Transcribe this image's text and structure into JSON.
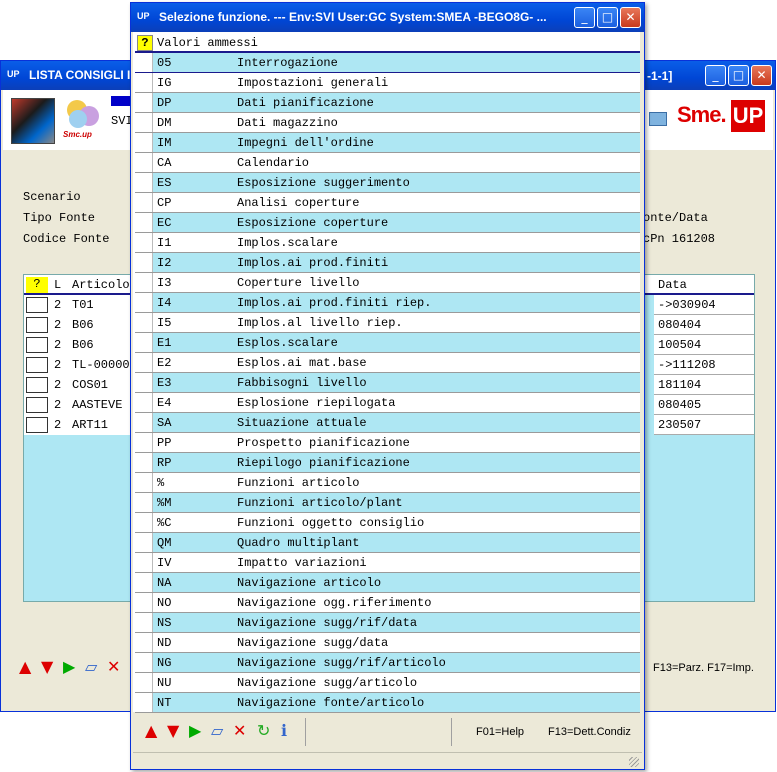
{
  "background_window": {
    "title": "LISTA CONSIGLI I",
    "title_right": "-1-1]",
    "toolbar": {
      "partial_text": "SVI",
      "logo_small": "Smc.up",
      "logo_sme": "Sme.",
      "logo_up": "UP"
    },
    "fields": [
      {
        "label": "Scenario",
        "value": ""
      },
      {
        "label": "Tipo Fonte",
        "value": "onte/Data"
      },
      {
        "label": "Codice Fonte",
        "value": "cPn  161208"
      }
    ],
    "table": {
      "headers": {
        "q": "?",
        "l": "L",
        "articolo": "Articolo",
        "data": "Data"
      },
      "rows": [
        {
          "l": "2",
          "articolo": "T01",
          "data": "->030904"
        },
        {
          "l": "2",
          "articolo": "B06",
          "data": "080404"
        },
        {
          "l": "2",
          "articolo": "B06",
          "data": "100504"
        },
        {
          "l": "2",
          "articolo": "TL-00000",
          "data": "->111208"
        },
        {
          "l": "2",
          "articolo": "COS01",
          "data": "181104"
        },
        {
          "l": "2",
          "articolo": "AASTEVE",
          "data": "080405"
        },
        {
          "l": "2",
          "articolo": "ART11",
          "data": "230507"
        }
      ]
    },
    "fkeys": "F13=Parz.  F17=Imp."
  },
  "dialog": {
    "title": "Selezione funzione. --- Env:SVI User:GC System:SMEA -BEGO8G- ...",
    "list_header": "Valori ammessi",
    "question_mark": "?",
    "options": [
      {
        "code": "05",
        "desc": "Interrogazione"
      },
      {
        "code": "IG",
        "desc": "Impostazioni generali"
      },
      {
        "code": "DP",
        "desc": "Dati pianificazione"
      },
      {
        "code": "DM",
        "desc": "Dati magazzino"
      },
      {
        "code": "IM",
        "desc": "Impegni dell'ordine"
      },
      {
        "code": "CA",
        "desc": "Calendario"
      },
      {
        "code": "ES",
        "desc": "Esposizione suggerimento"
      },
      {
        "code": "CP",
        "desc": "Analisi coperture"
      },
      {
        "code": "EC",
        "desc": "Esposizione coperture"
      },
      {
        "code": "I1",
        "desc": "Implos.scalare"
      },
      {
        "code": "I2",
        "desc": "Implos.ai prod.finiti"
      },
      {
        "code": "I3",
        "desc": "Coperture livello"
      },
      {
        "code": "I4",
        "desc": "Implos.ai prod.finiti riep."
      },
      {
        "code": "I5",
        "desc": "Implos.al livello riep."
      },
      {
        "code": "E1",
        "desc": "Esplos.scalare"
      },
      {
        "code": "E2",
        "desc": "Esplos.ai mat.base"
      },
      {
        "code": "E3",
        "desc": "Fabbisogni livello"
      },
      {
        "code": "E4",
        "desc": "Esplosione riepilogata"
      },
      {
        "code": "SA",
        "desc": "Situazione attuale"
      },
      {
        "code": "PP",
        "desc": "Prospetto pianificazione"
      },
      {
        "code": "RP",
        "desc": "Riepilogo pianificazione"
      },
      {
        "code": "%",
        "desc": "Funzioni articolo"
      },
      {
        "code": "%M",
        "desc": "Funzioni articolo/plant"
      },
      {
        "code": "%C",
        "desc": "Funzioni oggetto consiglio"
      },
      {
        "code": "QM",
        "desc": "Quadro multiplant"
      },
      {
        "code": "IV",
        "desc": "Impatto variazioni"
      },
      {
        "code": "NA",
        "desc": "Navigazione articolo"
      },
      {
        "code": "NO",
        "desc": "Navigazione ogg.riferimento"
      },
      {
        "code": "NS",
        "desc": "Navigazione sugg/rif/data"
      },
      {
        "code": "ND",
        "desc": "Navigazione sugg/data"
      },
      {
        "code": "NG",
        "desc": "Navigazione sugg/rif/articolo"
      },
      {
        "code": "NU",
        "desc": "Navigazione sugg/articolo"
      },
      {
        "code": "NT",
        "desc": "Navigazione fonte/articolo"
      }
    ],
    "fkeys": {
      "help": "F01=Help",
      "detail": "F13=Dett.Condiz"
    }
  },
  "icons": {
    "arrow_up": "▲",
    "arrow_down": "▼",
    "play": "▶",
    "eraser": "▱",
    "close_x": "✕",
    "refresh": "↻",
    "info": "ℹ",
    "minimize": "_",
    "maximize": "□",
    "close": "✕"
  },
  "colors": {
    "row_cyan": "#aee7f3",
    "title_blue": "#0046d5",
    "brand_red": "#d00000"
  }
}
